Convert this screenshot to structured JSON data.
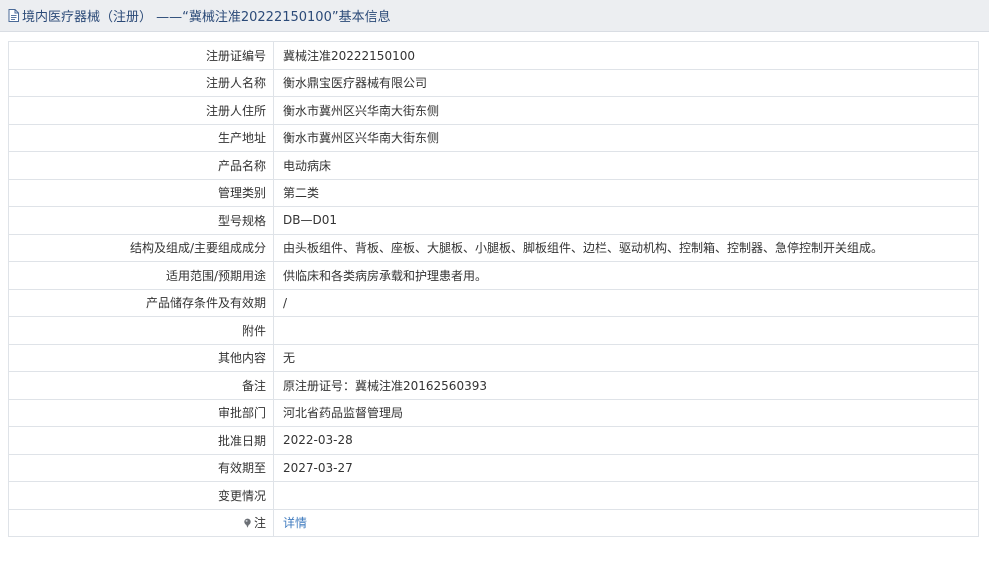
{
  "header": {
    "title": "境内医疗器械（注册） ——“冀械注准20222150100”基本信息",
    "icon": "document-icon"
  },
  "rows": [
    {
      "label": "注册证编号",
      "value": "冀械注准20222150100"
    },
    {
      "label": "注册人名称",
      "value": "衡水鼎宝医疗器械有限公司"
    },
    {
      "label": "注册人住所",
      "value": "衡水市冀州区兴华南大街东侧"
    },
    {
      "label": "生产地址",
      "value": "衡水市冀州区兴华南大街东侧"
    },
    {
      "label": "产品名称",
      "value": "电动病床"
    },
    {
      "label": "管理类别",
      "value": "第二类"
    },
    {
      "label": "型号规格",
      "value": "DB—D01"
    },
    {
      "label": "结构及组成/主要组成成分",
      "value": "由头板组件、背板、座板、大腿板、小腿板、脚板组件、边栏、驱动机构、控制箱、控制器、急停控制开关组成。"
    },
    {
      "label": "适用范围/预期用途",
      "value": "供临床和各类病房承载和护理患者用。"
    },
    {
      "label": "产品储存条件及有效期",
      "value": "/"
    },
    {
      "label": "附件",
      "value": ""
    },
    {
      "label": "其他内容",
      "value": "无"
    },
    {
      "label": "备注",
      "value": "原注册证号：冀械注准20162560393"
    },
    {
      "label": "审批部门",
      "value": "河北省药品监督管理局"
    },
    {
      "label": "批准日期",
      "value": "2022-03-28"
    },
    {
      "label": "有效期至",
      "value": "2027-03-27"
    },
    {
      "label": "变更情况",
      "value": ""
    }
  ],
  "note_row": {
    "label": "注",
    "icon": "pin-icon",
    "link_text": "详情"
  },
  "colors": {
    "header_bg": "#eceef1",
    "title_text": "#2b4a78",
    "link": "#3f7bbf",
    "border": "#dfe3e8"
  }
}
